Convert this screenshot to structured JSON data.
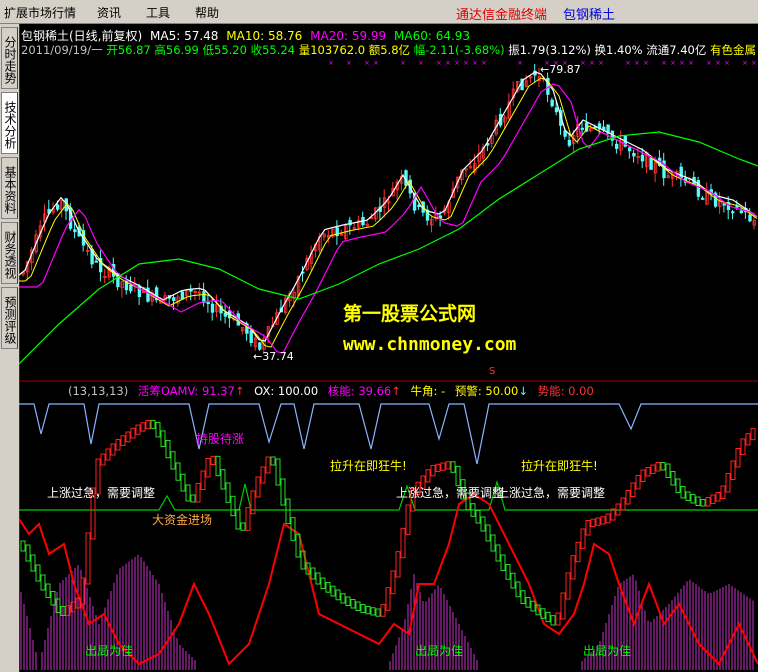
{
  "menu": {
    "items": [
      "扩展市场行情",
      "资讯",
      "工具",
      "帮助"
    ],
    "brand_text": "通达信金融终端",
    "stock_link": "包钢稀土"
  },
  "sidebar": {
    "tabs": [
      "分时走势",
      "技术分析",
      "基本资料",
      "财务透视",
      "预测评级"
    ],
    "active_index": 1
  },
  "main_chart": {
    "title": "包钢稀土(日线,前复权)",
    "ma5": "MA5: 57.48",
    "ma10": "MA10: 58.76",
    "ma20": "MA20: 59.99",
    "ma60": "MA60: 64.93",
    "date": "2011/09/19/一",
    "open": "开56.87",
    "high": "高56.99",
    "low": "低55.20",
    "close": "收55.24",
    "volume": "量103762.0",
    "amount": "额5.8亿",
    "change": "幅-2.11(-3.68%)",
    "amplitude": "振1.79(3.12%)",
    "turnover": "换1.40%",
    "float": "流通7.40亿",
    "sector": "有色金属",
    "high_label": "79.87",
    "low_label": "37.74",
    "colors": {
      "ma5": "#ffffff",
      "ma10": "#ffff00",
      "ma20": "#ff00ff",
      "ma60": "#00ff00",
      "up": "#ff3232",
      "down": "#54fcfc"
    }
  },
  "watermark": {
    "line1": "第一股票公式网",
    "line2": "www.chnmoney.com"
  },
  "indicator": {
    "params": "(13,13,13)",
    "oamv": "活筹OAMV: 91.37",
    "ox": "OX: 100.00",
    "core": "核能: 39.66",
    "bull": "牛角: -",
    "warn": "预警: 50.00",
    "power": "势能: 0.00",
    "marker": "S",
    "labels": {
      "hold": "持股待涨",
      "rise1": "拉升在即狂牛!",
      "rise2": "拉升在即狂牛!",
      "adjust1": "上涨过急，需要调整",
      "adjust2": "上涨过急，需要调整",
      "adjust3": "上涨过急，需要调整",
      "big_money": "大资金进场",
      "exit1": "出局为佳",
      "exit2": "出局为佳",
      "exit3": "出局为佳"
    }
  }
}
